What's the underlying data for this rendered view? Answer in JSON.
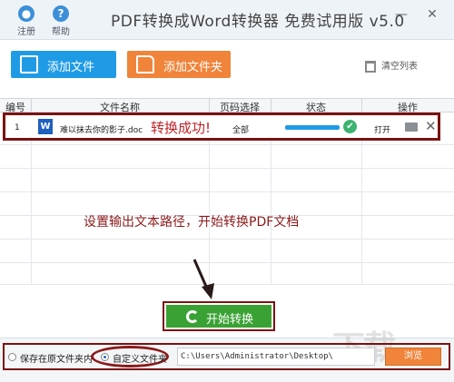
{
  "titlebar": {
    "title": "PDF转换成Word转换器 免费试用版 v5.0",
    "register_label": "注册",
    "help_label": "帮助",
    "minimize_glyph": "—",
    "close_glyph": "✕"
  },
  "toolbar": {
    "add_file_label": "添加文件",
    "add_folder_label": "添加文件夹",
    "clear_list_label": "清空列表"
  },
  "table": {
    "headers": [
      "编号",
      "文件名称",
      "页码选择",
      "状态",
      "操作"
    ],
    "rows": [
      {
        "index": "1",
        "file_name": "难以抹去你的影子.doc",
        "page_select": "全部",
        "progress": 1.0,
        "action_open": "打开"
      }
    ]
  },
  "annotations": {
    "success_text": "转换成功!",
    "hint_text": "设置输出文本路径，开始转换PDF文档"
  },
  "start_button_label": "开始转换",
  "output": {
    "option_original": "保存在原文件夹内",
    "option_custom": "自定义文件夹",
    "selected": "custom",
    "path_value": "C:\\Users\\Administrator\\Desktop\\",
    "browse_label": "浏览"
  },
  "colors": {
    "accent_blue": "#1f9be6",
    "accent_orange": "#f0843a",
    "start_green": "#3aa234",
    "annotation_red": "#8b1a1a"
  },
  "icons": [
    "register-icon",
    "help-icon",
    "file-icon",
    "folder-icon",
    "trash-icon",
    "word-doc-icon",
    "check-icon",
    "open-folder-icon",
    "close-icon",
    "refresh-icon"
  ]
}
